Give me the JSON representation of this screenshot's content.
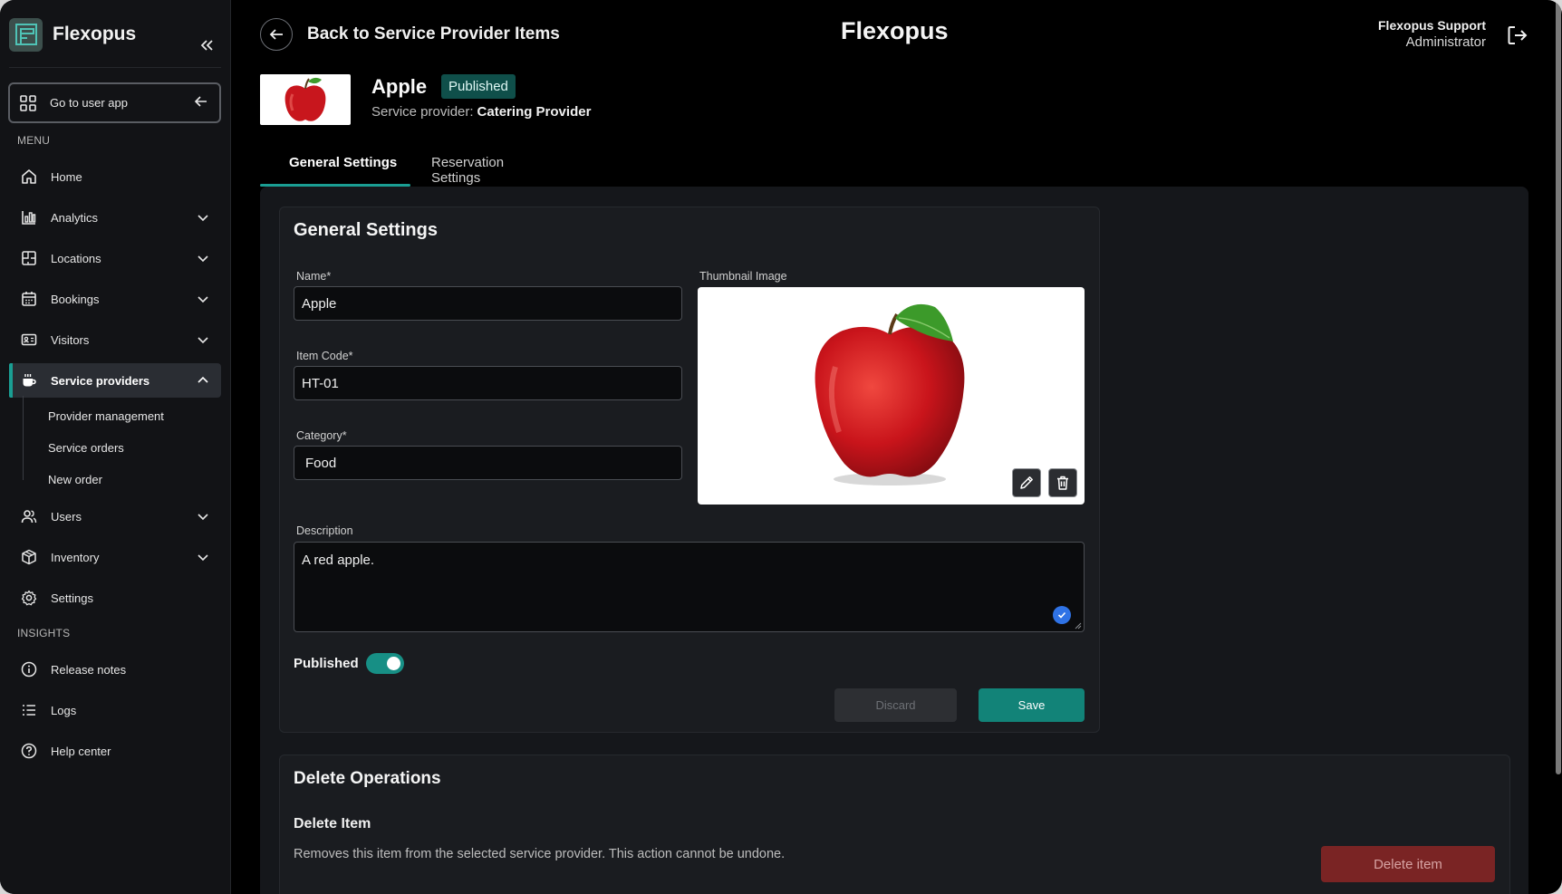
{
  "sidebar": {
    "brand": "Flexopus",
    "go_to_user_app": "Go to user app",
    "menu_label": "MENU",
    "insights_label": "INSIGHTS",
    "items": {
      "home": "Home",
      "analytics": "Analytics",
      "locations": "Locations",
      "bookings": "Bookings",
      "visitors": "Visitors",
      "service_providers": "Service providers",
      "users": "Users",
      "inventory": "Inventory",
      "settings": "Settings",
      "release_notes": "Release notes",
      "logs": "Logs",
      "help_center": "Help center"
    },
    "sub_items": {
      "provider_management": "Provider management",
      "service_orders": "Service orders",
      "new_order": "New order"
    }
  },
  "header": {
    "back_label": "Back to Service Provider Items",
    "app_title": "Flexopus",
    "user_name": "Flexopus Support",
    "user_role": "Administrator"
  },
  "item": {
    "name": "Apple",
    "status_badge": "Published",
    "provider_label": "Service provider:",
    "provider_name": "Catering Provider"
  },
  "tabs": {
    "general": "General Settings",
    "reservation": "Reservation Settings"
  },
  "general_settings": {
    "title": "General Settings",
    "name_label": "Name*",
    "name_value": "Apple",
    "item_code_label": "Item Code*",
    "item_code_value": "HT-01",
    "category_label": "Category*",
    "category_value": "Food",
    "thumbnail_label": "Thumbnail Image",
    "description_label": "Description",
    "description_value": "A red apple.",
    "published_label": "Published",
    "published": true,
    "discard_label": "Discard",
    "save_label": "Save"
  },
  "delete_ops": {
    "title": "Delete Operations",
    "subtitle": "Delete Item",
    "description": "Removes this item from the selected service provider. This action cannot be undone.",
    "button_label": "Delete item"
  },
  "colors": {
    "accent": "#1a9e93",
    "badge_bg": "#0f4f4a",
    "danger": "#7a2424"
  }
}
